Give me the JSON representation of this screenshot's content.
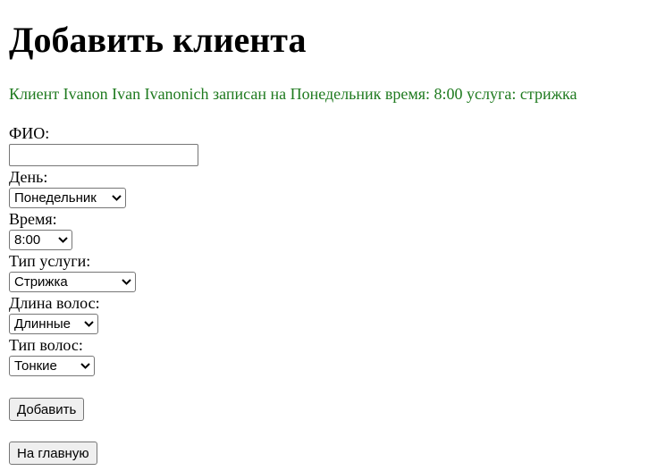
{
  "page": {
    "title": "Добавить клиента",
    "status_message": "Клиент Ivanon Ivan Ivanonich записан на Понедельник время: 8:00 услуга: стрижка",
    "status_color": "#1f7a1f"
  },
  "form": {
    "fio": {
      "label": "ФИО:",
      "value": "",
      "placeholder": ""
    },
    "day": {
      "label": "День:",
      "selected": "Понедельник"
    },
    "time": {
      "label": "Время:",
      "selected": "8:00"
    },
    "service_type": {
      "label": "Тип услуги:",
      "selected": "Стрижка"
    },
    "hair_length": {
      "label": "Длина волос:",
      "selected": "Длинные"
    },
    "hair_type": {
      "label": "Тип волос:",
      "selected": "Тонкие"
    },
    "submit_label": "Добавить"
  },
  "nav": {
    "home_label": "На главную"
  },
  "icons": {
    "select_arrow": "chevron-down-icon"
  }
}
